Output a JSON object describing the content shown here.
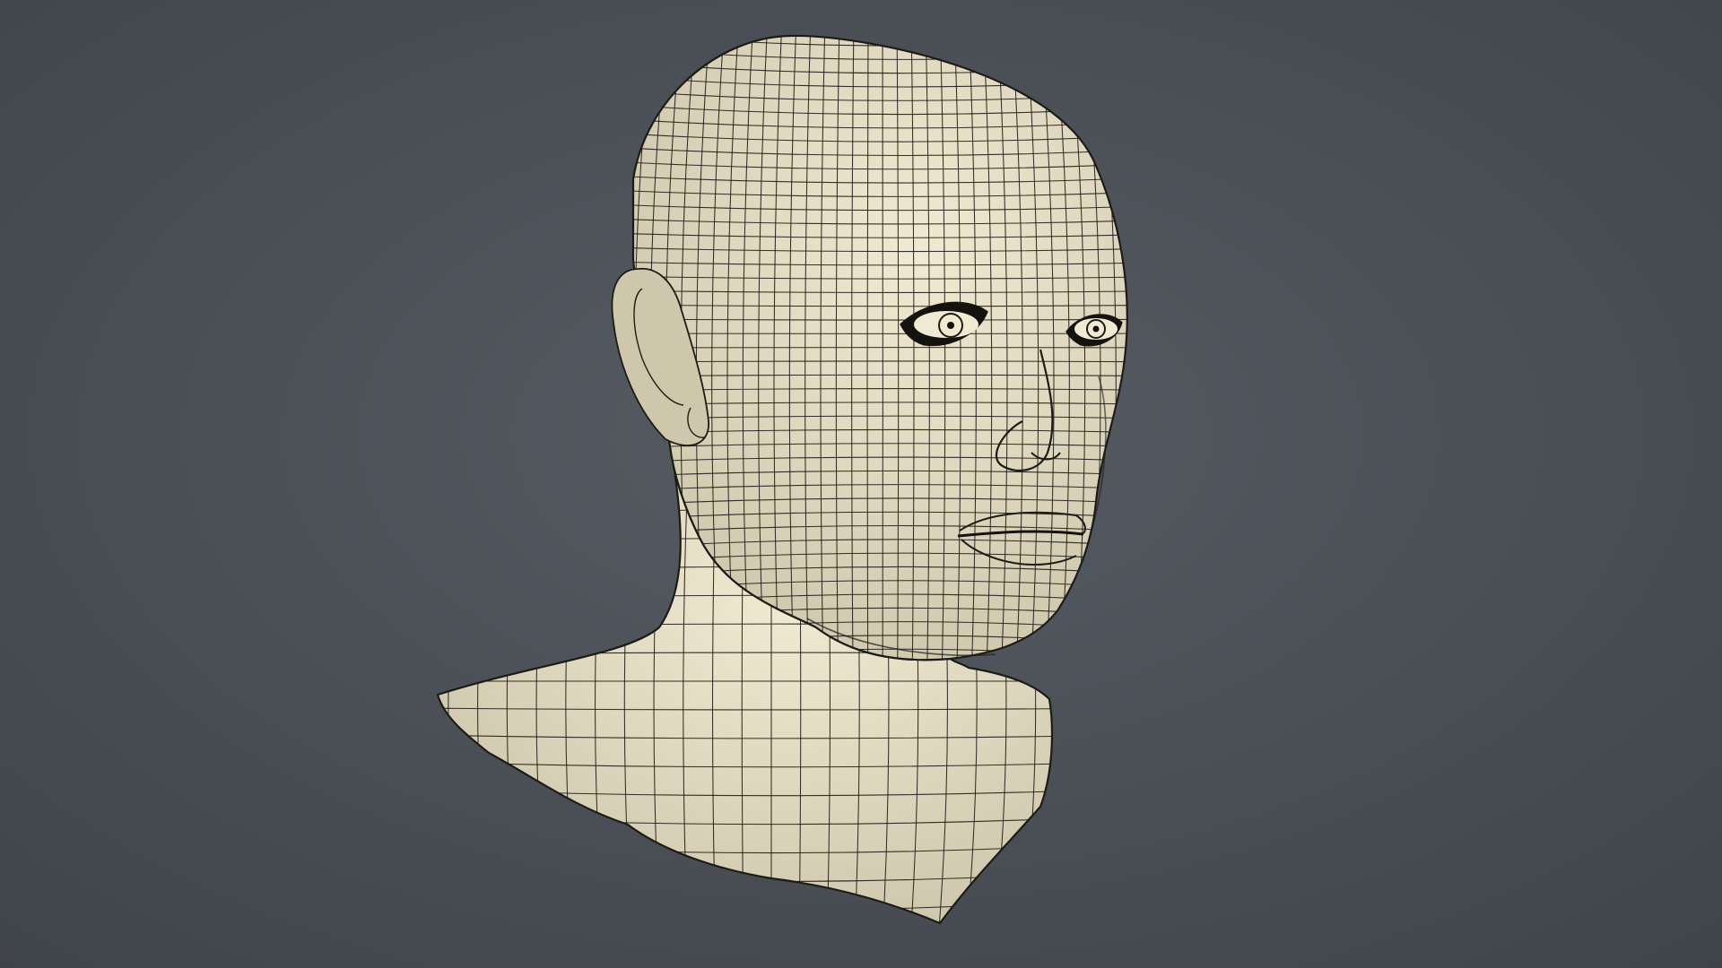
{
  "scene": {
    "subject": "wireframe-head-bust",
    "colors": {
      "background_center": "#565c63",
      "background_edge": "#3f444a",
      "surface": "#f1ead2",
      "surface_shadow": "#cfc7ac",
      "wire": "#1c1c16",
      "eye_dark": "#15130f"
    }
  }
}
